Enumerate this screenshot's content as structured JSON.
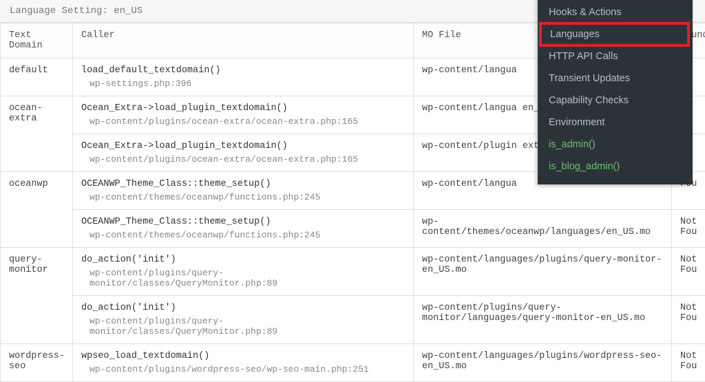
{
  "lang_setting_label": "Language Setting: en_US",
  "headers": {
    "text_domain": "Text Domain",
    "caller": "Caller",
    "mo_file": "MO File",
    "found": "Found"
  },
  "rows": [
    {
      "domain": "default",
      "caller": "load_default_textdomain()",
      "caller_sub": "wp-settings.php:396",
      "mo": "wp-content/langua",
      "found": ""
    },
    {
      "domain": "ocean-extra",
      "caller": "Ocean_Extra->load_plugin_textdomain()",
      "caller_sub": "wp-content/plugins/ocean-extra/ocean-extra.php:165",
      "mo": "wp-content/langua\nen_US.mo",
      "found": ""
    },
    {
      "domain": "",
      "caller": "Ocean_Extra->load_plugin_textdomain()",
      "caller_sub": "wp-content/plugins/ocean-extra/ocean-extra.php:165",
      "mo": "wp-content/plugin\nextra/languages/o",
      "found": ""
    },
    {
      "domain": "oceanwp",
      "caller": "OCEANWP_Theme_Class::theme_setup()",
      "caller_sub": "wp-content/themes/oceanwp/functions.php:245",
      "mo": "wp-content/langua",
      "found": "Fou"
    },
    {
      "domain": "",
      "caller": "OCEANWP_Theme_Class::theme_setup()",
      "caller_sub": "wp-content/themes/oceanwp/functions.php:245",
      "mo": "wp-content/themes/oceanwp/languages/en_US.mo",
      "found": "Not Fou"
    },
    {
      "domain": "query-monitor",
      "caller": "do_action('init')",
      "caller_sub": "wp-content/plugins/query-monitor/classes/QueryMonitor.php:89",
      "mo": "wp-content/languages/plugins/query-monitor-en_US.mo",
      "found": "Not Fou"
    },
    {
      "domain": "",
      "caller": "do_action('init')",
      "caller_sub": "wp-content/plugins/query-monitor/classes/QueryMonitor.php:89",
      "mo": "wp-content/plugins/query-monitor/languages/query-monitor-en_US.mo",
      "found": "Not Fou"
    },
    {
      "domain": "wordpress-seo",
      "caller": "wpseo_load_textdomain()",
      "caller_sub": "wp-content/plugins/wordpress-seo/wp-seo-main.php:251",
      "mo": "wp-content/languages/plugins/wordpress-seo-en_US.mo",
      "found": "Not Fou"
    }
  ],
  "popup": {
    "items": [
      "Hooks & Actions",
      "Languages",
      "HTTP API Calls",
      "Transient Updates",
      "Capability Checks",
      "Environment",
      "is_admin()",
      "is_blog_admin()"
    ]
  }
}
